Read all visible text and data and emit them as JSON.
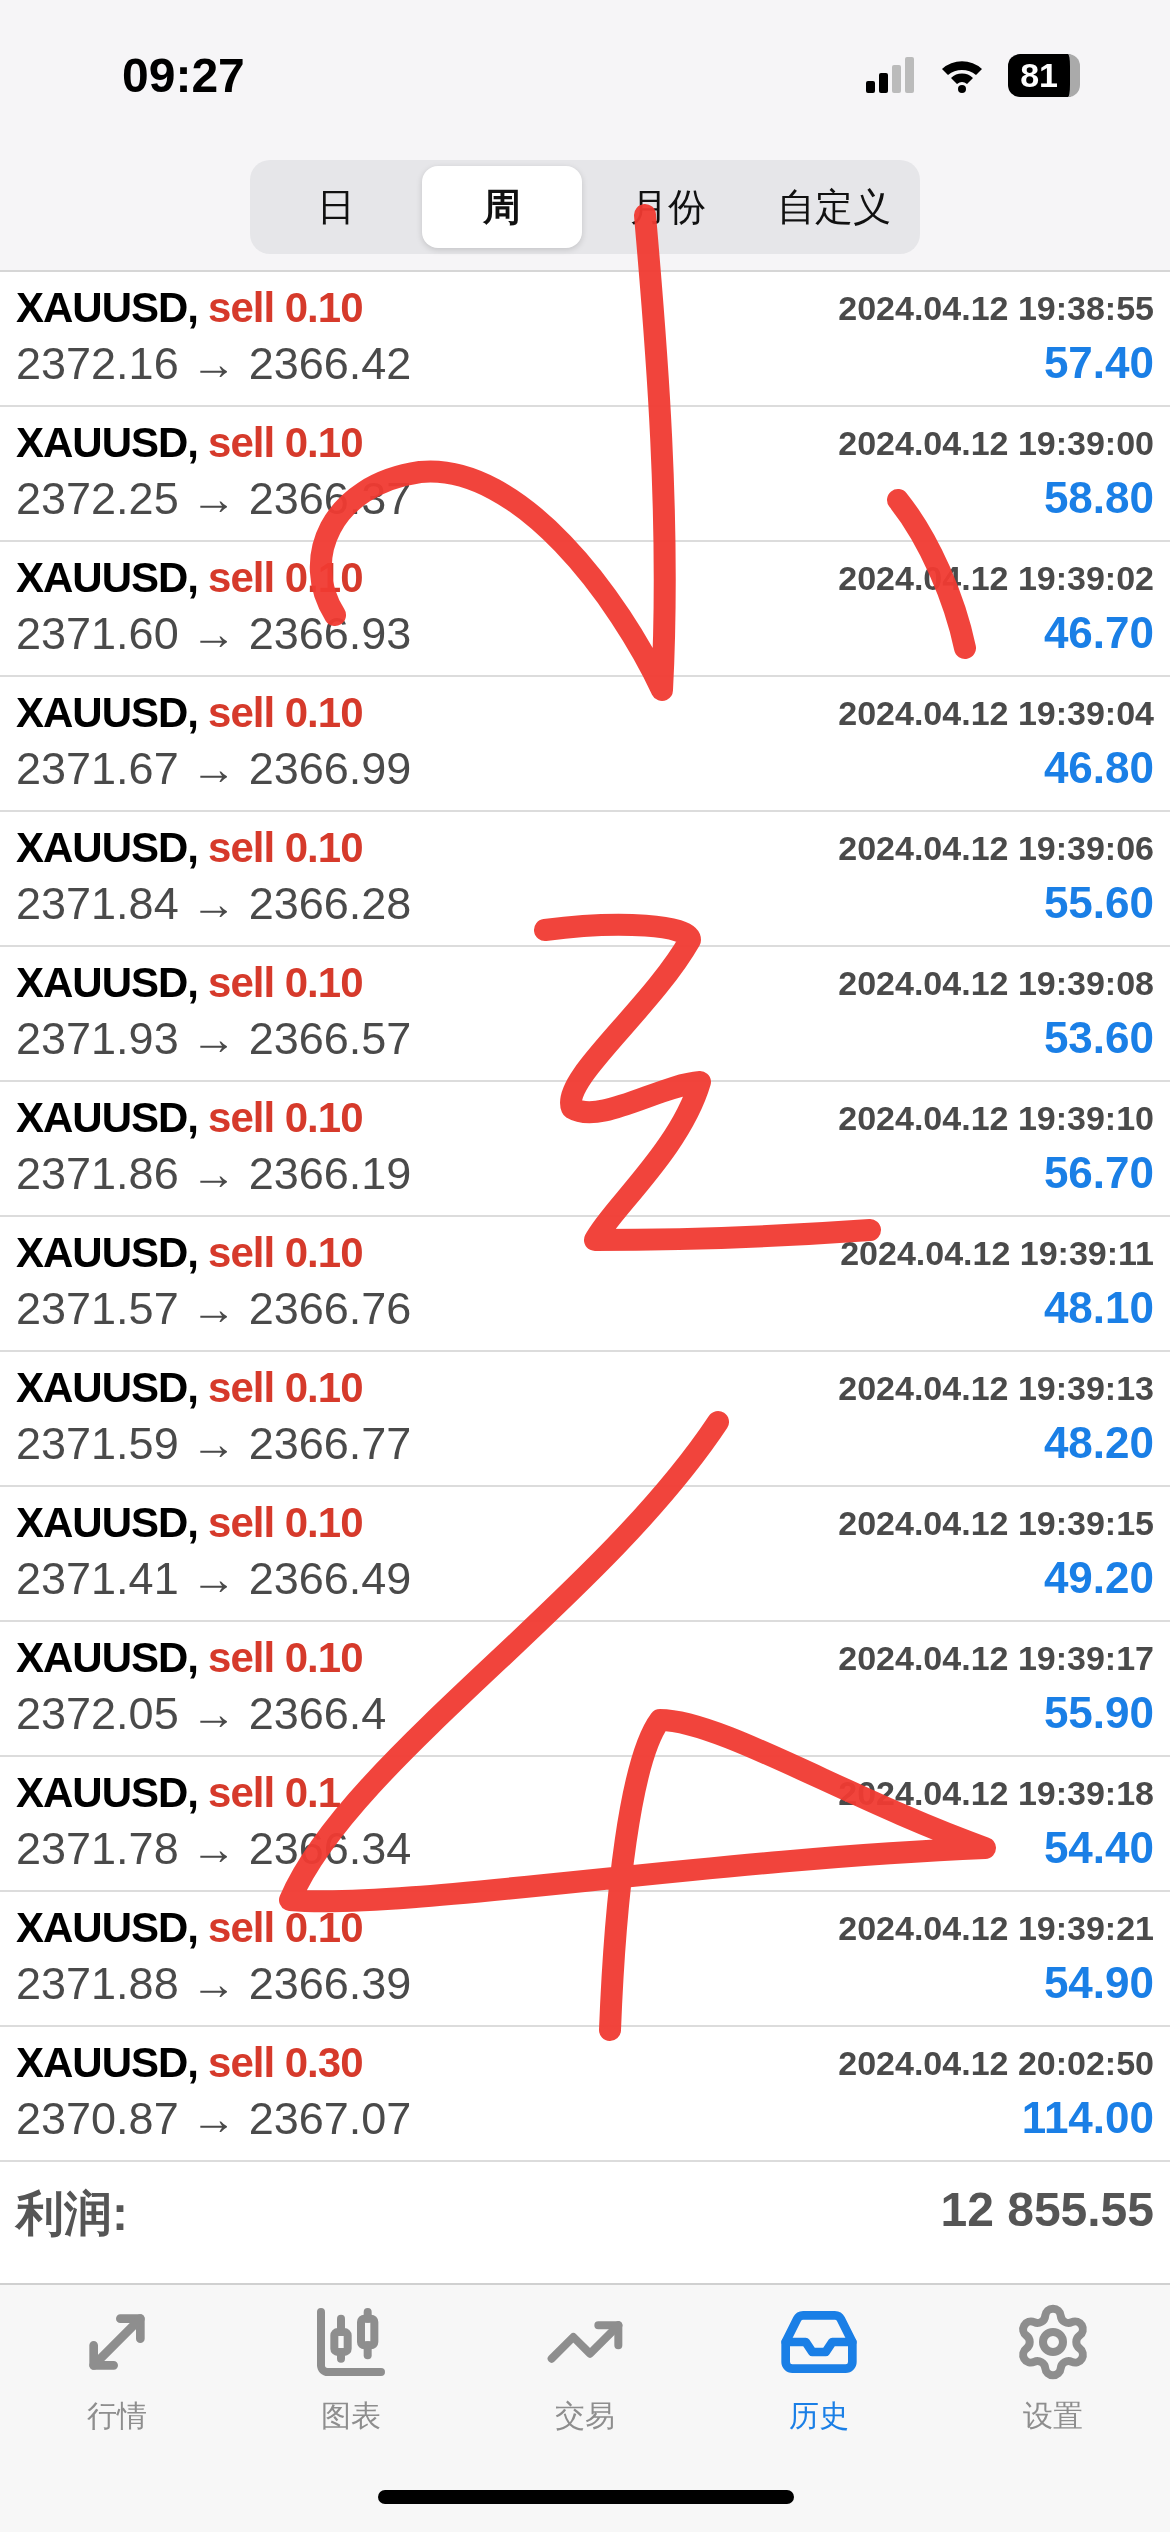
{
  "status_bar": {
    "time": "09:27",
    "battery": "81"
  },
  "period_tabs": [
    {
      "label": "日",
      "selected": false
    },
    {
      "label": "周",
      "selected": true
    },
    {
      "label": "月份",
      "selected": false
    },
    {
      "label": "自定义",
      "selected": false
    }
  ],
  "trades": [
    {
      "symbol": "XAUUSD,",
      "side": "sell 0.10",
      "time": "2024.04.12 19:38:55",
      "prices": "2372.16 → 2366.42",
      "profit": "57.40"
    },
    {
      "symbol": "XAUUSD,",
      "side": "sell 0.10",
      "time": "2024.04.12 19:39:00",
      "prices": "2372.25 → 2366.37",
      "profit": "58.80"
    },
    {
      "symbol": "XAUUSD,",
      "side": "sell 0.10",
      "time": "2024.04.12 19:39:02",
      "prices": "2371.60 → 2366.93",
      "profit": "46.70"
    },
    {
      "symbol": "XAUUSD,",
      "side": "sell 0.10",
      "time": "2024.04.12 19:39:04",
      "prices": "2371.67 → 2366.99",
      "profit": "46.80"
    },
    {
      "symbol": "XAUUSD,",
      "side": "sell 0.10",
      "time": "2024.04.12 19:39:06",
      "prices": "2371.84 → 2366.28",
      "profit": "55.60"
    },
    {
      "symbol": "XAUUSD,",
      "side": "sell 0.10",
      "time": "2024.04.12 19:39:08",
      "prices": "2371.93 → 2366.57",
      "profit": "53.60"
    },
    {
      "symbol": "XAUUSD,",
      "side": "sell 0.10",
      "time": "2024.04.12 19:39:10",
      "prices": "2371.86 → 2366.19",
      "profit": "56.70"
    },
    {
      "symbol": "XAUUSD,",
      "side": "sell 0.10",
      "time": "2024.04.12 19:39:11",
      "prices": "2371.57 → 2366.76",
      "profit": "48.10"
    },
    {
      "symbol": "XAUUSD,",
      "side": "sell 0.10",
      "time": "2024.04.12 19:39:13",
      "prices": "2371.59 → 2366.77",
      "profit": "48.20"
    },
    {
      "symbol": "XAUUSD,",
      "side": "sell 0.10",
      "time": "2024.04.12 19:39:15",
      "prices": "2371.41 → 2366.49",
      "profit": "49.20"
    },
    {
      "symbol": "XAUUSD,",
      "side": "sell 0.10",
      "time": "2024.04.12 19:39:17",
      "prices": "2372.05 → 2366.4",
      "profit": "55.90"
    },
    {
      "symbol": "XAUUSD,",
      "side": "sell 0.1",
      "time": "2024.04.12 19:39:18",
      "prices": "2371.78 → 2366.34",
      "profit": "54.40"
    },
    {
      "symbol": "XAUUSD,",
      "side": "sell 0.10",
      "time": "2024.04.12 19:39:21",
      "prices": "2371.88 → 2366.39",
      "profit": "54.90"
    },
    {
      "symbol": "XAUUSD,",
      "side": "sell 0.30",
      "time": "2024.04.12 20:02:50",
      "prices": "2370.87 → 2367.07",
      "profit": "114.00"
    }
  ],
  "summary": {
    "label": "利润:",
    "value": "12 855.55"
  },
  "tab_bar": [
    {
      "label": "行情",
      "kind": "quotes",
      "selected": false
    },
    {
      "label": "图表",
      "kind": "chart",
      "selected": false
    },
    {
      "label": "交易",
      "kind": "trade",
      "selected": false
    },
    {
      "label": "历史",
      "kind": "history",
      "selected": true
    },
    {
      "label": "设置",
      "kind": "settings",
      "selected": false
    }
  ]
}
